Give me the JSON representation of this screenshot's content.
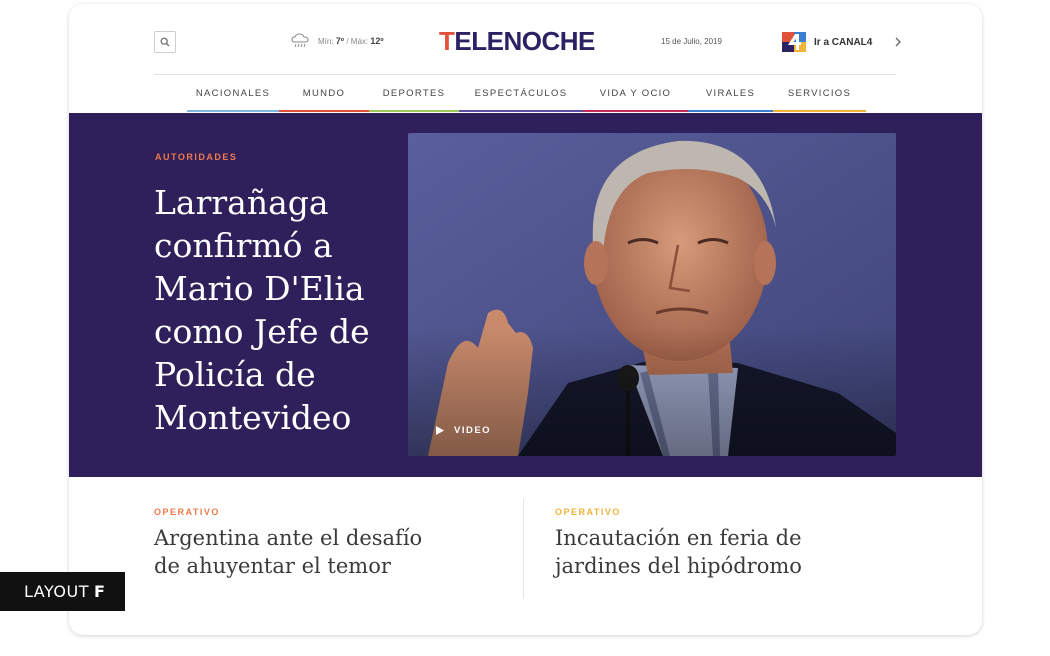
{
  "header": {
    "search_icon": "search-icon",
    "weather": {
      "icon": "rain-cloud-icon",
      "min_label": "Mín:",
      "min_value": "7º",
      "separator": "/",
      "max_label": "Máx:",
      "max_value": "12º"
    },
    "logo_first": "T",
    "logo_rest": "ELENOCHE",
    "date": "15 de Julio, 2019",
    "canal": {
      "icon": "canal4-logo-icon",
      "label": "Ir a CANAL4"
    }
  },
  "nav": {
    "items": [
      {
        "label": "NACIONALES",
        "color": "#7fb8e0"
      },
      {
        "label": "MUNDO",
        "color": "#e0523a"
      },
      {
        "label": "DEPORTES",
        "color": "#9cc95a"
      },
      {
        "label": "ESPECTÁCULOS",
        "color": "#5b4fa8"
      },
      {
        "label": "VIDA Y OCIO",
        "color": "#c02f54"
      },
      {
        "label": "VIRALES",
        "color": "#3b7fd0"
      },
      {
        "label": "SERVICIOS",
        "color": "#f0b43a"
      }
    ]
  },
  "hero": {
    "kicker": "AUTORIDADES",
    "title": "Larrañaga confirmó a Mario D'Elia como  Jefe de Policía de Montevideo",
    "video_label": "VIDEO",
    "background_color": "#2f1f5a"
  },
  "stories": [
    {
      "kicker": "OPERATIVO",
      "kicker_color": "#f07a4a",
      "title": "Argentina ante el desafío de ahuyentar el temor"
    },
    {
      "kicker": "OPERATIVO",
      "kicker_color": "#f0b43a",
      "title": "Incautación en feria de jardines del hipódromo"
    }
  ],
  "layout_label": {
    "prefix": "LAYOUT",
    "letter": "F"
  }
}
